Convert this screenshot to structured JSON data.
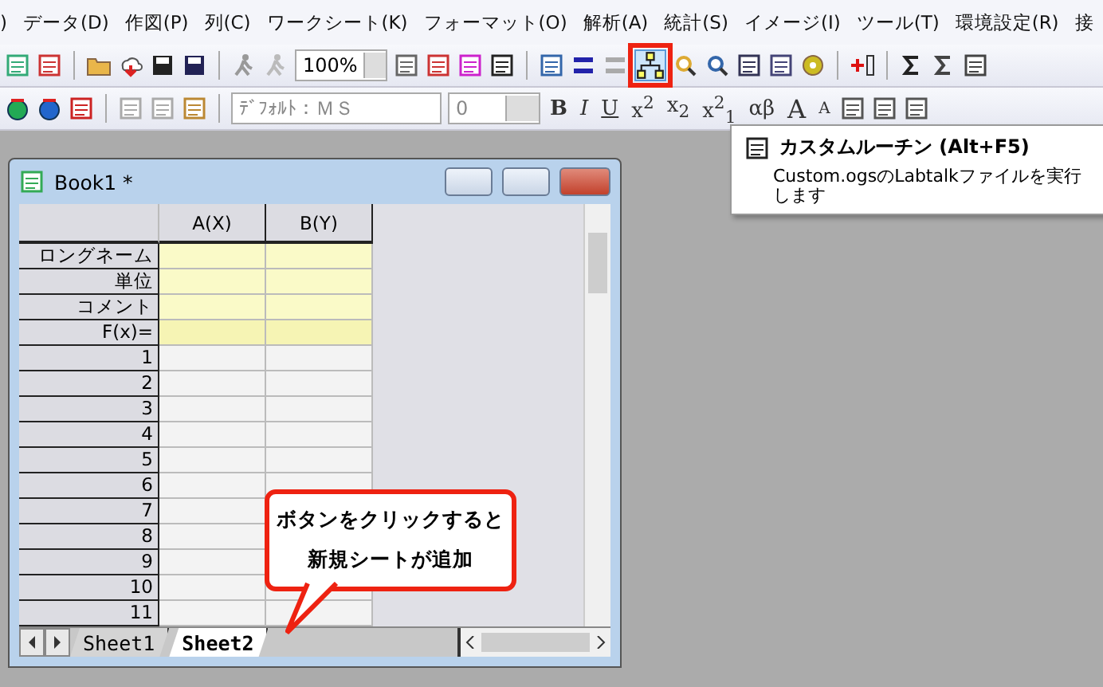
{
  "menu": [
    ")",
    "データ(D)",
    "作図(P)",
    "列(C)",
    "ワークシート(K)",
    "フォーマット(O)",
    "解析(A)",
    "統計(S)",
    "イメージ(I)",
    "ツール(T)",
    "環境設定(R)",
    "接"
  ],
  "toolbar_1": {
    "zoom": "100%",
    "custom_routine_highlighted": true
  },
  "toolbar_2": {
    "font": "ﾃﾞﾌｫﾙﾄ：ＭＳ",
    "size": "0",
    "format_buttons": [
      {
        "label": "B",
        "kind": "bold"
      },
      {
        "label": "I",
        "kind": "italic"
      },
      {
        "label": "U",
        "kind": "underline"
      },
      {
        "label": "x$^{2}$",
        "kind": "plain"
      },
      {
        "label": "x$_{2}$",
        "kind": "plain"
      },
      {
        "label": "x$^{2}$$_{1}$",
        "kind": "plain"
      },
      {
        "label": "αβ",
        "kind": "plain"
      },
      {
        "label": "A",
        "kind": "large"
      },
      {
        "label": "A",
        "kind": "small"
      }
    ]
  },
  "tooltip": {
    "title": "カスタムルーチン (Alt+F5)",
    "description": "Custom.ogsのLabtalkファイルを実行します"
  },
  "book_window": {
    "title": "Book1 *",
    "columns": [
      "A(X)",
      "B(Y)"
    ],
    "label_rows": [
      "ロングネーム",
      "単位",
      "コメント",
      "F(x)="
    ],
    "rows": [
      "1",
      "2",
      "3",
      "4",
      "5",
      "6",
      "7",
      "8",
      "9",
      "10",
      "11"
    ],
    "sheet_tabs": [
      {
        "label": "Sheet1",
        "selected": false
      },
      {
        "label": "Sheet2",
        "selected": true
      }
    ]
  },
  "callout": {
    "lines": [
      "ボタンをクリックすると",
      "新規シートが追加"
    ]
  }
}
